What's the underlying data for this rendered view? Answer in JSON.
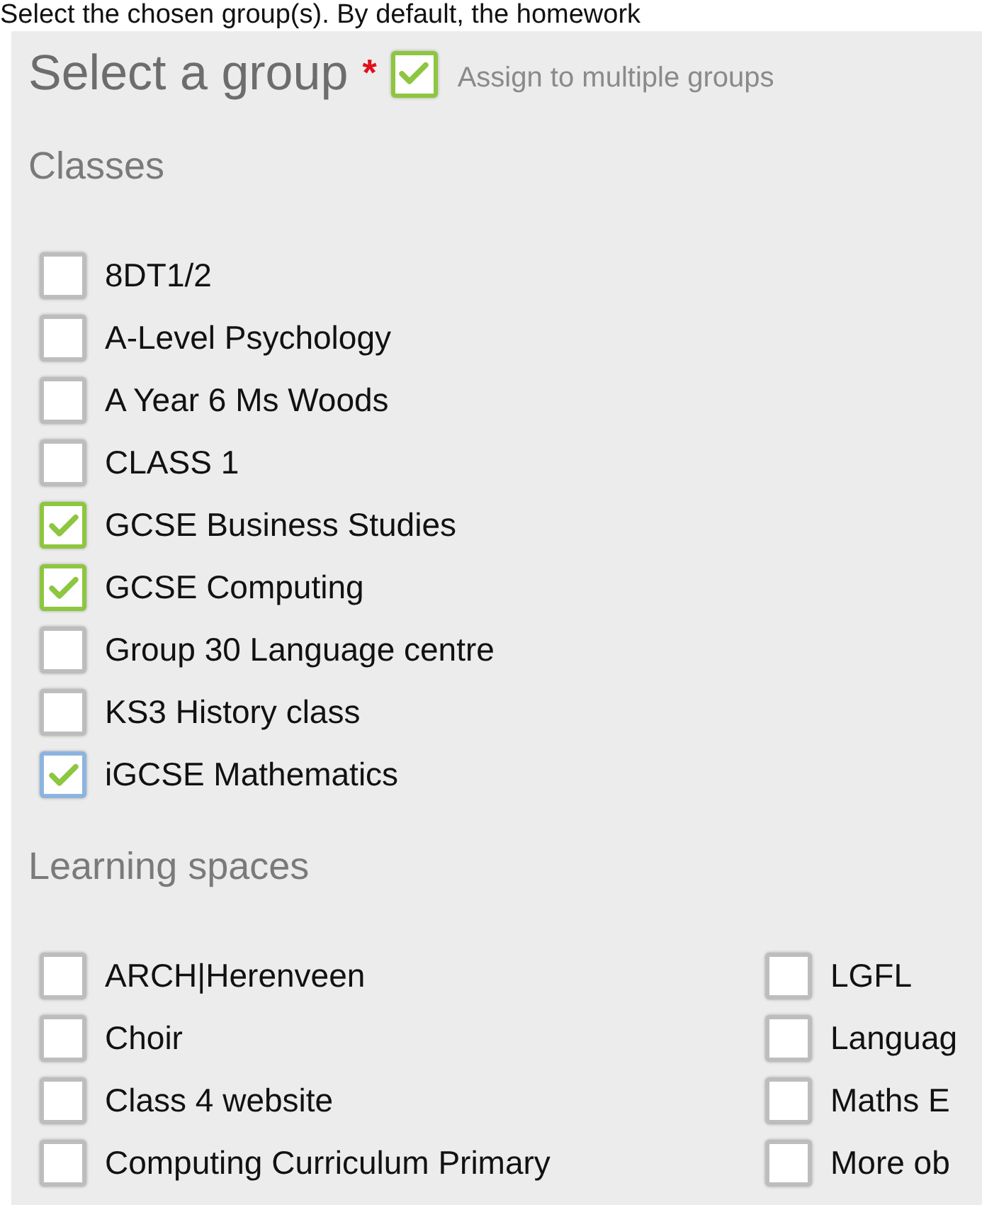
{
  "intro": "Select the chosen group(s). By default, the homework",
  "header": {
    "title": "Select a group",
    "required_mark": "*",
    "multiple": {
      "label": "Assign to multiple groups",
      "checked": true
    }
  },
  "sections": [
    {
      "title": "Classes",
      "items": [
        {
          "label": "8DT1/2",
          "checked": false,
          "focused": false
        },
        {
          "label": "A-Level Psychology",
          "checked": false,
          "focused": false
        },
        {
          "label": "A Year 6 Ms Woods",
          "checked": false,
          "focused": false
        },
        {
          "label": "CLASS 1",
          "checked": false,
          "focused": false
        },
        {
          "label": "GCSE Business Studies",
          "checked": true,
          "focused": false
        },
        {
          "label": "GCSE Computing",
          "checked": true,
          "focused": false
        },
        {
          "label": "Group 30 Language centre",
          "checked": false,
          "focused": false
        },
        {
          "label": "KS3 History class",
          "checked": false,
          "focused": false
        },
        {
          "label": "iGCSE Mathematics",
          "checked": true,
          "focused": true
        }
      ]
    },
    {
      "title": "Learning spaces",
      "items": [
        {
          "label": "ARCH|Herenveen",
          "checked": false,
          "focused": false
        },
        {
          "label": "LGFL",
          "checked": false,
          "focused": false
        },
        {
          "label": "Choir",
          "checked": false,
          "focused": false
        },
        {
          "label": "Languag",
          "checked": false,
          "focused": false
        },
        {
          "label": "Class 4 website",
          "checked": false,
          "focused": false
        },
        {
          "label": "Maths E",
          "checked": false,
          "focused": false
        },
        {
          "label": "Computing Curriculum Primary",
          "checked": false,
          "focused": false
        },
        {
          "label": "More ob",
          "checked": false,
          "focused": false
        }
      ]
    }
  ]
}
